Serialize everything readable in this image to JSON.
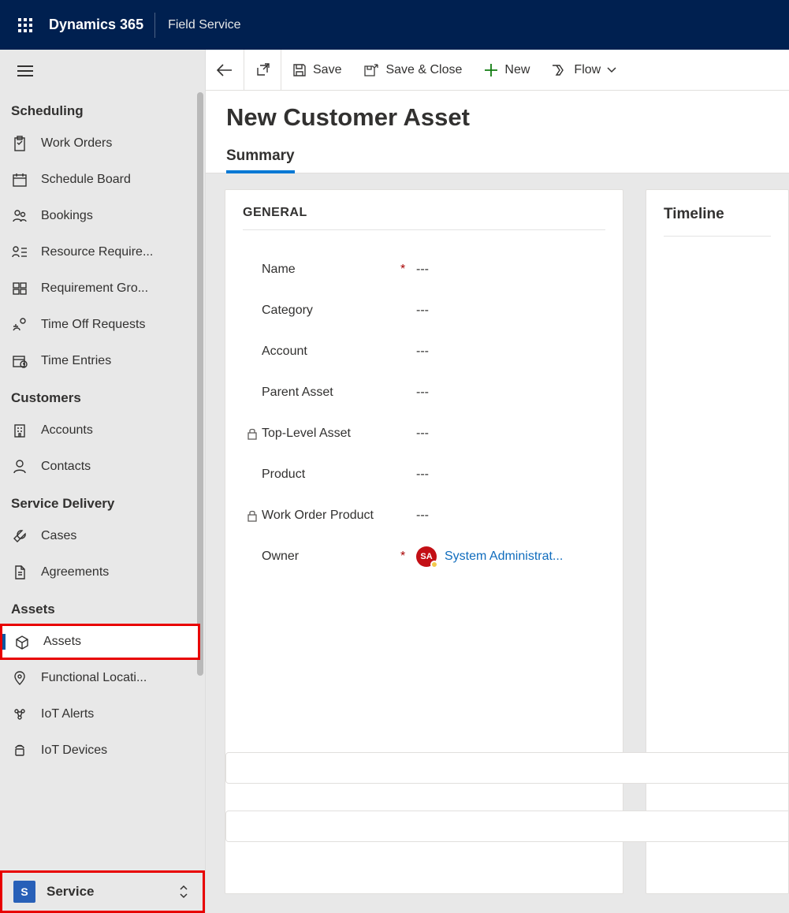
{
  "header": {
    "brand": "Dynamics 365",
    "app": "Field Service"
  },
  "commandBar": {
    "save": "Save",
    "saveClose": "Save & Close",
    "new": "New",
    "flow": "Flow"
  },
  "page": {
    "title": "New Customer Asset",
    "tabs": [
      "Summary"
    ],
    "activeTab": "Summary"
  },
  "general": {
    "section": "GENERAL",
    "fields": [
      {
        "label": "Name",
        "required": true,
        "locked": false,
        "value": "---"
      },
      {
        "label": "Category",
        "required": false,
        "locked": false,
        "value": "---"
      },
      {
        "label": "Account",
        "required": false,
        "locked": false,
        "value": "---"
      },
      {
        "label": "Parent Asset",
        "required": false,
        "locked": false,
        "value": "---"
      },
      {
        "label": "Top-Level Asset",
        "required": false,
        "locked": true,
        "value": "---"
      },
      {
        "label": "Product",
        "required": false,
        "locked": false,
        "value": "---"
      },
      {
        "label": "Work Order Product",
        "required": false,
        "locked": true,
        "value": "---"
      }
    ],
    "owner": {
      "label": "Owner",
      "required": true,
      "initials": "SA",
      "name": "System Administrat..."
    }
  },
  "timeline": {
    "title": "Timeline"
  },
  "sidebar": {
    "groups": [
      {
        "title": "Scheduling",
        "items": [
          {
            "id": "work-orders",
            "label": "Work Orders",
            "icon": "clipboard"
          },
          {
            "id": "schedule-board",
            "label": "Schedule Board",
            "icon": "calendar"
          },
          {
            "id": "bookings",
            "label": "Bookings",
            "icon": "people"
          },
          {
            "id": "resource-req",
            "label": "Resource Require...",
            "icon": "list-person"
          },
          {
            "id": "requirement-groups",
            "label": "Requirement Gro...",
            "icon": "group-block"
          },
          {
            "id": "time-off",
            "label": "Time Off Requests",
            "icon": "vacation"
          },
          {
            "id": "time-entries",
            "label": "Time Entries",
            "icon": "calendar-clock"
          }
        ]
      },
      {
        "title": "Customers",
        "items": [
          {
            "id": "accounts",
            "label": "Accounts",
            "icon": "building"
          },
          {
            "id": "contacts",
            "label": "Contacts",
            "icon": "person"
          }
        ]
      },
      {
        "title": "Service Delivery",
        "items": [
          {
            "id": "cases",
            "label": "Cases",
            "icon": "wrench"
          },
          {
            "id": "agreements",
            "label": "Agreements",
            "icon": "document"
          }
        ]
      },
      {
        "title": "Assets",
        "items": [
          {
            "id": "assets",
            "label": "Assets",
            "icon": "package",
            "active": true,
            "highlight": true
          },
          {
            "id": "functional-locations",
            "label": "Functional Locati...",
            "icon": "pin"
          },
          {
            "id": "iot-alerts",
            "label": "IoT Alerts",
            "icon": "iot-alert"
          },
          {
            "id": "iot-devices",
            "label": "IoT Devices",
            "icon": "iot-device"
          }
        ]
      }
    ],
    "area": {
      "chip": "S",
      "label": "Service",
      "highlight": true
    }
  }
}
